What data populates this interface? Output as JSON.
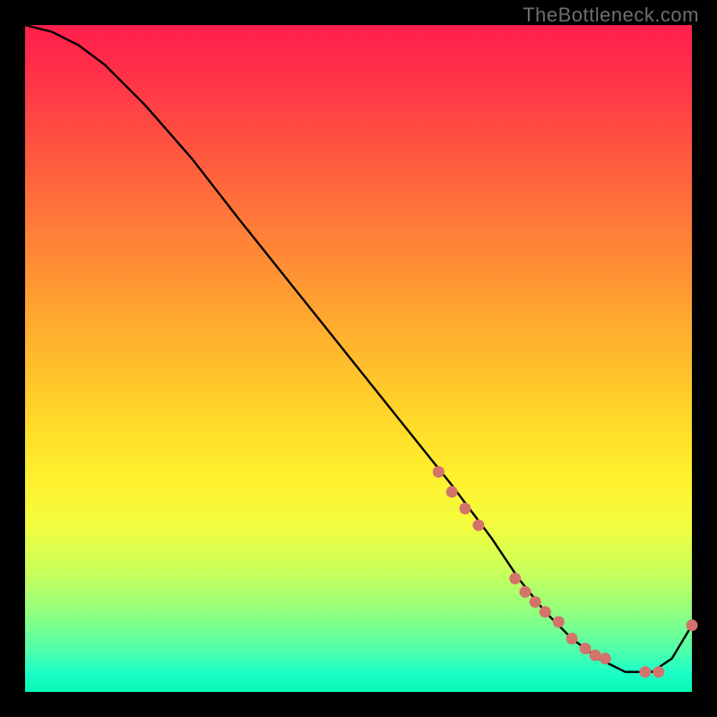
{
  "watermark": "TheBottleneck.com",
  "chart_data": {
    "type": "line",
    "title": "",
    "xlabel": "",
    "ylabel": "",
    "xlim": [
      0,
      100
    ],
    "ylim": [
      0,
      100
    ],
    "series": [
      {
        "name": "curve",
        "x": [
          0,
          4,
          8,
          12,
          18,
          25,
          32,
          40,
          48,
          56,
          64,
          70,
          74,
          78,
          82,
          86,
          90,
          94,
          97,
          100
        ],
        "y": [
          100,
          99,
          97,
          94,
          88,
          80,
          71,
          61,
          51,
          41,
          31,
          23,
          17,
          12,
          8,
          5,
          3,
          3,
          5,
          10
        ]
      }
    ],
    "markers": {
      "name": "highlight-dots",
      "color": "#d4736c",
      "x": [
        62,
        64,
        66,
        68,
        73.5,
        75,
        76.5,
        78,
        80,
        82,
        84,
        85.5,
        87,
        93,
        95,
        100
      ],
      "y": [
        33,
        30,
        27.5,
        25,
        17,
        15,
        13.5,
        12,
        10.5,
        8,
        6.5,
        5.5,
        5,
        3,
        3,
        10
      ]
    }
  }
}
